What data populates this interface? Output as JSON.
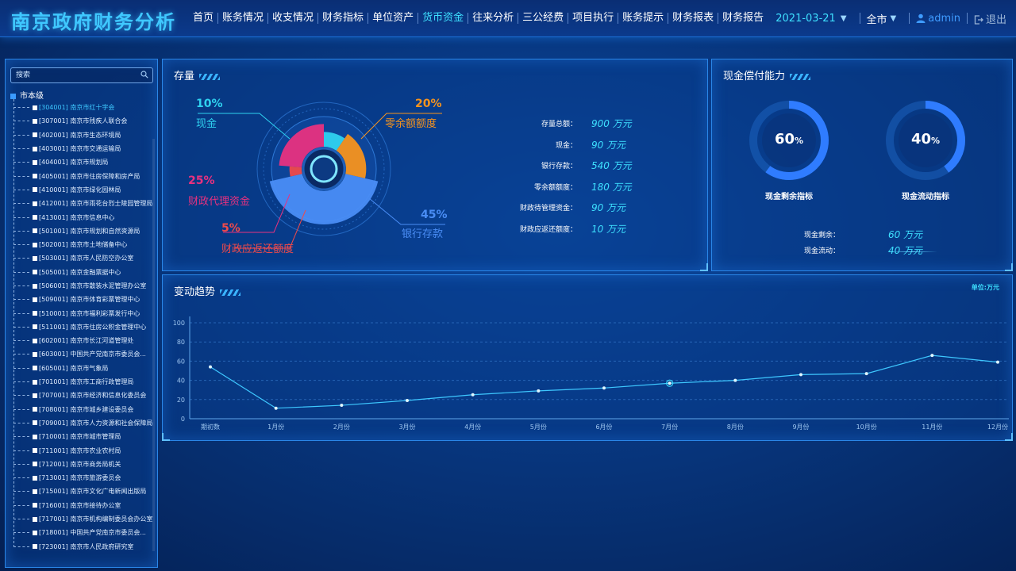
{
  "header": {
    "title": "南京政府财务分析",
    "nav": [
      "首页",
      "账务情况",
      "收支情况",
      "财务指标",
      "单位资产",
      "货币资金",
      "往来分析",
      "三公经费",
      "项目执行",
      "账务提示",
      "财务报表",
      "财务报告"
    ],
    "active_nav": "货币资金",
    "date": "2021-03-21",
    "region": "全市",
    "user": "admin",
    "logout": "退出"
  },
  "sidebar": {
    "search_placeholder": "搜索",
    "root": "市本级",
    "items": [
      "[304001] 南京市红十字会",
      "[307001] 南京市残疾人联合会",
      "[402001] 南京市生态环境局",
      "[403001] 南京市交通运输局",
      "[404001] 南京市规划局",
      "[405001] 南京市住房保障和房产局",
      "[410001] 南京市绿化园林局",
      "[412001] 南京市雨花台烈士陵园管理局",
      "[413001] 南京市信息中心",
      "[501001] 南京市规划和自然资源局",
      "[502001] 南京市土地储备中心",
      "[503001] 南京市人民防空办公室",
      "[505001] 南京金融票据中心",
      "[506001] 南京市散装水泥管理办公室",
      "[509001] 南京市体育彩票管理中心",
      "[510001] 南京市福利彩票发行中心",
      "[511001] 南京市住房公积金管理中心",
      "[602001] 南京市长江河道管理处",
      "[603001] 中国共产党南京市委员会...",
      "[605001] 南京市气象局",
      "[701001] 南京市工商行政管理局",
      "[707001] 南京市经济和信息化委员会",
      "[708001] 南京市城乡建设委员会",
      "[709001] 南京市人力资源和社会保障局",
      "[710001] 南京市城市管理局",
      "[711001] 南京市农业农村局",
      "[712001] 南京市商务局机关",
      "[713001] 南京市旅游委员会",
      "[715001] 南京市文化广电新闻出版局",
      "[716001] 南京市接待办公室",
      "[717001] 南京市机构编制委员会办公室",
      "[718001] 中国共产党南京市委员会...",
      "[723001] 南京市人民政府研究室"
    ],
    "selected_index": 0
  },
  "stock": {
    "title": "存量",
    "pie": [
      {
        "name": "现金",
        "pct": "10%",
        "value": 10,
        "color": "#2fd2f0"
      },
      {
        "name": "零余额额度",
        "pct": "20%",
        "value": 20,
        "color": "#f7941d"
      },
      {
        "name": "银行存款",
        "pct": "45%",
        "value": 45,
        "color": "#4a8df5"
      },
      {
        "name": "财政应返还额度",
        "pct": "5%",
        "value": 5,
        "color": "#f04a4a"
      },
      {
        "name": "财政代理资金",
        "pct": "25%",
        "value": 25,
        "color": "#e8317f"
      }
    ],
    "stats": [
      {
        "label": "存量总额：",
        "value": "900 万元"
      },
      {
        "label": "现金：",
        "value": "90 万元"
      },
      {
        "label": "银行存款：",
        "value": "540 万元"
      },
      {
        "label": "零余额额度：",
        "value": "180 万元"
      },
      {
        "label": "财政待管理资金：",
        "value": "90 万元"
      },
      {
        "label": "财政应返还额度：",
        "value": "10 万元"
      }
    ]
  },
  "cash": {
    "title": "现金偿付能力",
    "gauges": [
      {
        "pct": 60,
        "num": "60",
        "unit": "%",
        "label": "现金剩余指标"
      },
      {
        "pct": 40,
        "num": "40",
        "unit": "%",
        "label": "现金流动指标"
      }
    ],
    "rows": [
      {
        "label": "现金剩余：",
        "value": "60 万元"
      },
      {
        "label": "现金流动：",
        "value": "40 万元"
      }
    ]
  },
  "trend": {
    "title": "变动趋势",
    "unit": "单位:万元"
  },
  "chart_data": {
    "type": "line",
    "categories": [
      "期初数",
      "1月份",
      "2月份",
      "3月份",
      "4月份",
      "5月份",
      "6月份",
      "7月份",
      "8月份",
      "9月份",
      "10月份",
      "11月份",
      "12月份"
    ],
    "values": [
      54,
      11,
      14,
      19,
      25,
      29,
      32,
      37,
      40,
      46,
      47,
      66,
      59
    ],
    "yticks": [
      0,
      20,
      40,
      60,
      80,
      100
    ],
    "ylim": [
      0,
      100
    ],
    "grid": true,
    "color": "#3ec8ff"
  }
}
